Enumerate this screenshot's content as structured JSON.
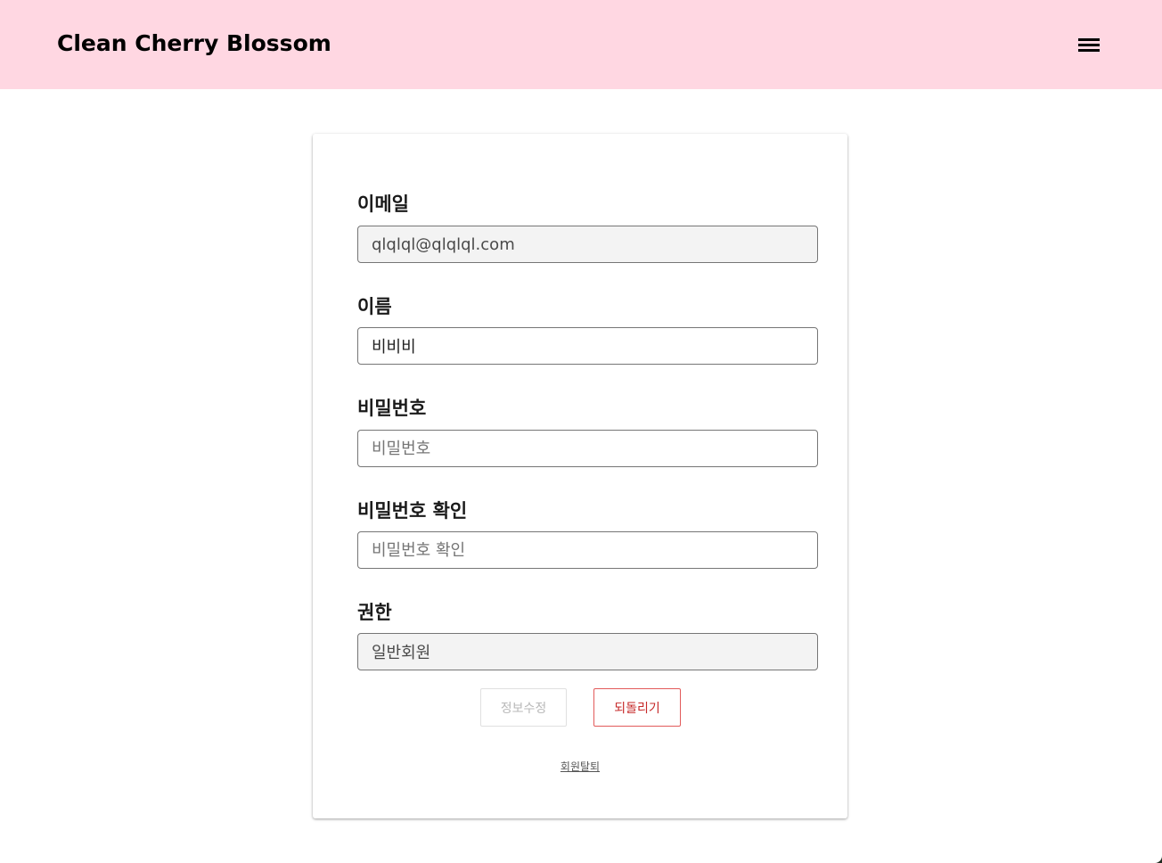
{
  "header": {
    "brand": "Clean Cherry Blossom",
    "menu_icon": "hamburger-menu-icon"
  },
  "form": {
    "email": {
      "label": "이메일",
      "value": "qlqlql@qlqlql.com",
      "readonly": true
    },
    "name": {
      "label": "이름",
      "value": "비비비"
    },
    "password": {
      "label": "비밀번호",
      "placeholder": "비밀번호",
      "value": ""
    },
    "password_confirm": {
      "label": "비밀번호 확인",
      "placeholder": "비밀번호 확인",
      "value": ""
    },
    "role": {
      "label": "권한",
      "value": "일반회원",
      "readonly": true
    }
  },
  "actions": {
    "edit_label": "정보수정",
    "revert_label": "되돌리기",
    "withdraw_label": "회원탈퇴"
  },
  "colors": {
    "header_bg": "#ffd7e2",
    "revert_border": "#e25a5a",
    "revert_text": "#c62828"
  }
}
